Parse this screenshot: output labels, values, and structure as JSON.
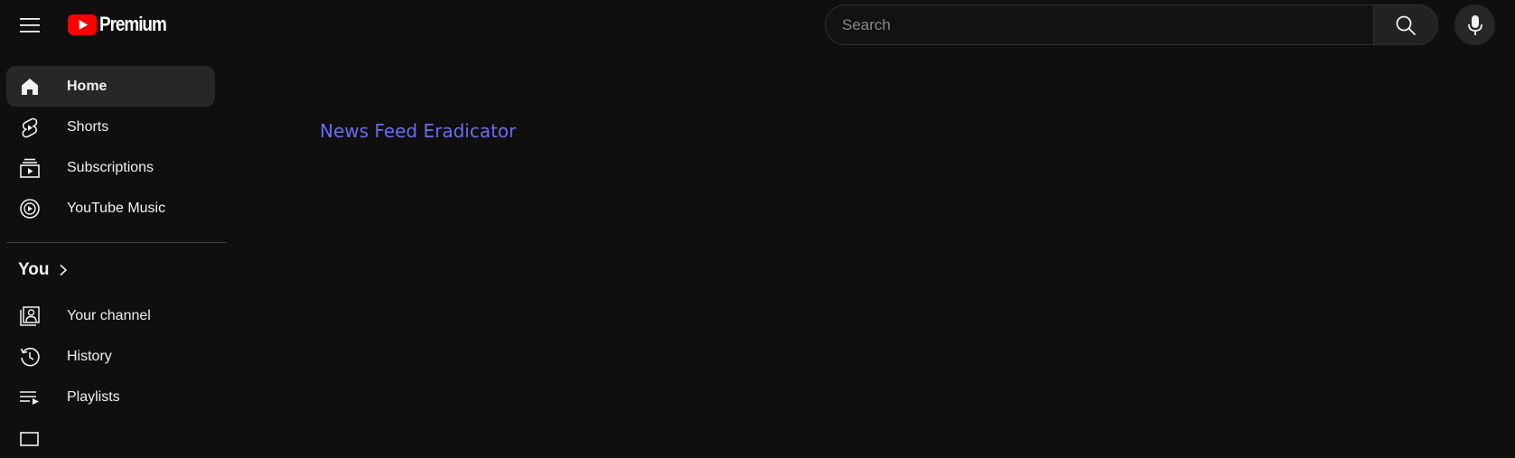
{
  "header": {
    "logo_text": "Premium",
    "search_placeholder": "Search",
    "icons": {
      "menu": "hamburger-menu-icon",
      "logo": "youtube-play-logo",
      "search": "search-icon",
      "mic": "microphone-icon"
    }
  },
  "sidebar": {
    "items": [
      {
        "label": "Home",
        "icon": "home-icon",
        "active": true
      },
      {
        "label": "Shorts",
        "icon": "shorts-icon"
      },
      {
        "label": "Subscriptions",
        "icon": "subscriptions-icon"
      },
      {
        "label": "YouTube Music",
        "icon": "youtube-music-icon"
      }
    ],
    "you_section": {
      "title": "You",
      "items": [
        {
          "label": "Your channel",
          "icon": "your-channel-icon"
        },
        {
          "label": "History",
          "icon": "history-icon"
        },
        {
          "label": "Playlists",
          "icon": "playlists-icon"
        }
      ]
    }
  },
  "main": {
    "eradicator_link": "News Feed Eradicator"
  },
  "colors": {
    "background": "#0f0f0f",
    "active_item": "#272727",
    "brand_red": "#ff0000",
    "link": "#6d6bf0"
  }
}
